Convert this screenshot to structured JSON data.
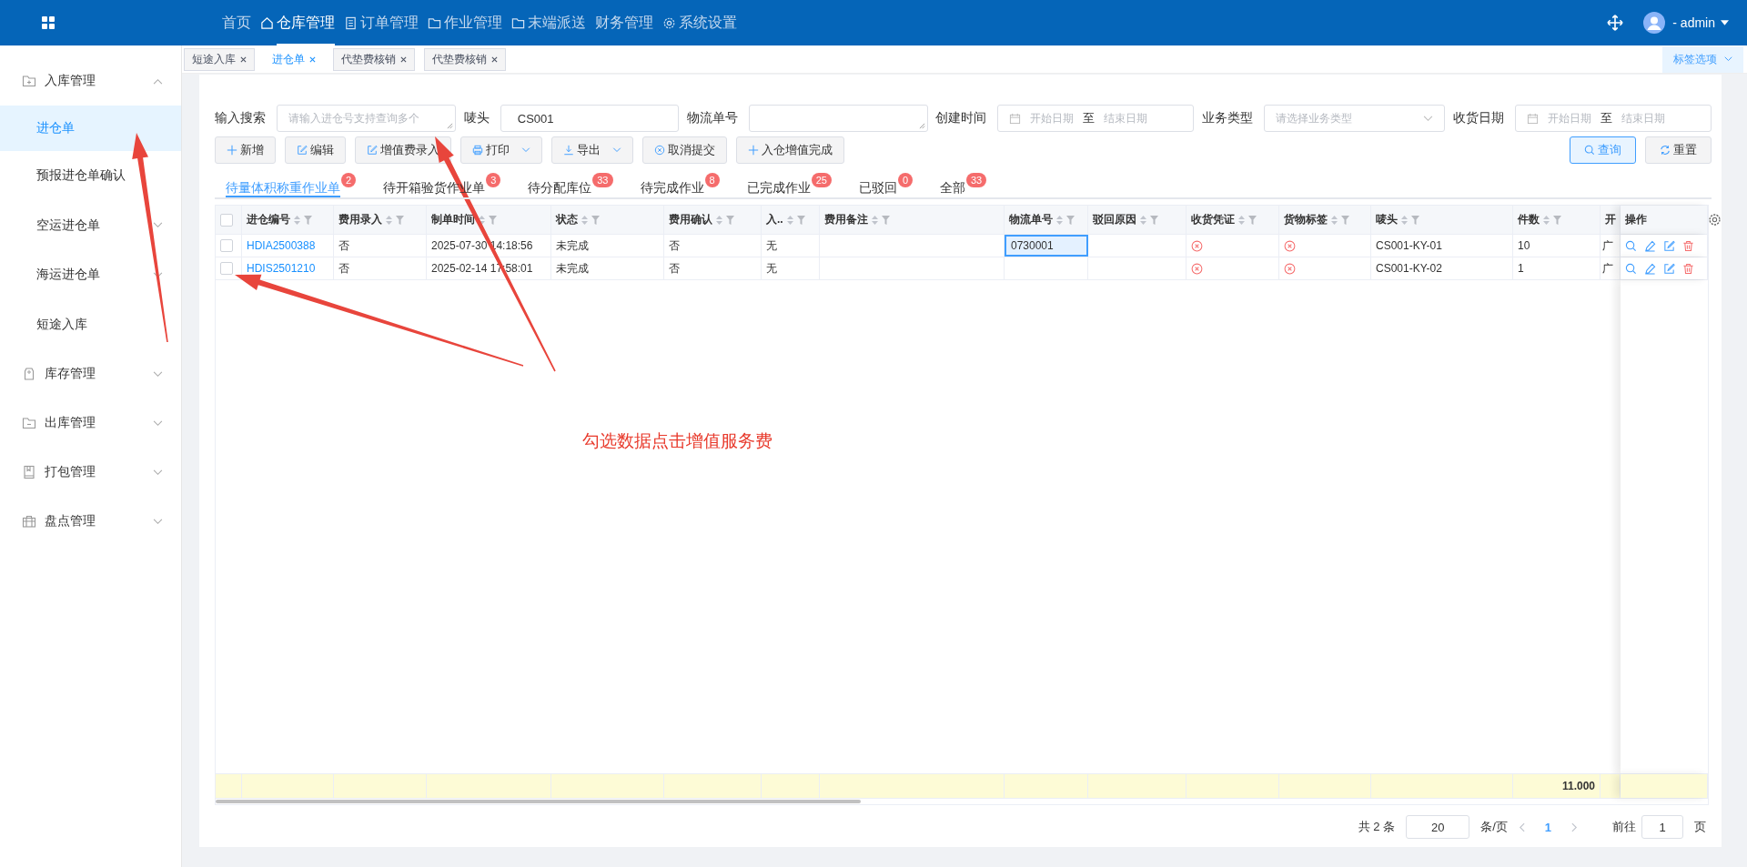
{
  "top_nav": {
    "items": [
      {
        "label": "首页",
        "selected": false
      },
      {
        "label": "仓库管理",
        "selected": true
      },
      {
        "label": "订单管理",
        "selected": false
      },
      {
        "label": "作业管理",
        "selected": false
      },
      {
        "label": "末端派送",
        "selected": false
      },
      {
        "label": "财务管理",
        "selected": false
      },
      {
        "label": "系统设置",
        "selected": false
      }
    ],
    "user": "- admin"
  },
  "tags": {
    "items": [
      {
        "label": "短途入库",
        "selected": false
      },
      {
        "label": "进仓单",
        "selected": true
      },
      {
        "label": "代垫费核销",
        "selected": false
      },
      {
        "label": "代垫费核销",
        "selected": false
      }
    ],
    "options_label": "标签选项"
  },
  "sidebar": {
    "items": [
      {
        "label": "入库管理",
        "expanded": true,
        "children": [
          {
            "label": "进仓单",
            "selected": true
          },
          {
            "label": "预报进仓单确认",
            "selected": false
          },
          {
            "label": "空运进仓单",
            "selected": false,
            "expanded": false
          },
          {
            "label": "海运进仓单",
            "selected": false,
            "expanded": false
          },
          {
            "label": "短途入库",
            "selected": false
          }
        ]
      },
      {
        "label": "库存管理",
        "expanded": false
      },
      {
        "label": "出库管理",
        "expanded": false
      },
      {
        "label": "打包管理",
        "expanded": false
      },
      {
        "label": "盘点管理",
        "expanded": false
      }
    ]
  },
  "filters": [
    {
      "kind": "textarea",
      "label": "输入搜索",
      "placeholder": "请输入进仓号支持查询多个"
    },
    {
      "kind": "input",
      "label": "唛头",
      "value": "CS001"
    },
    {
      "kind": "textarea",
      "label": "物流单号"
    },
    {
      "kind": "daterange",
      "label": "创建时间",
      "start_placeholder": "开始日期",
      "separator": "至",
      "end_placeholder": "结束日期"
    },
    {
      "kind": "select",
      "label": "业务类型",
      "placeholder": "请选择业务类型"
    },
    {
      "kind": "daterange",
      "label": "收货日期",
      "start_placeholder": "开始日期",
      "separator": "至",
      "end_placeholder": "结束日期"
    }
  ],
  "toolbar": [
    {
      "label": "新增",
      "dropdown": false
    },
    {
      "label": "编辑",
      "dropdown": false
    },
    {
      "label": "增值费录入",
      "dropdown": false
    },
    {
      "label": "打印",
      "dropdown": true
    },
    {
      "label": "导出",
      "dropdown": true
    },
    {
      "label": "取消提交",
      "dropdown": false
    },
    {
      "label": "入仓增值完成",
      "dropdown": false
    }
  ],
  "search_buttons": [
    {
      "label": "查询",
      "primary": true
    },
    {
      "label": "重置",
      "primary": false
    }
  ],
  "status_tabs": [
    {
      "label": "待量体积称重作业单",
      "count": "2",
      "selected": true
    },
    {
      "label": "待开箱验货作业单",
      "count": "3",
      "selected": false
    },
    {
      "label": "待分配库位",
      "count": "33",
      "selected": false
    },
    {
      "label": "待完成作业",
      "count": "8",
      "selected": false
    },
    {
      "label": "已完成作业",
      "count": "25",
      "selected": false
    },
    {
      "label": "已驳回",
      "count": "0",
      "selected": false
    },
    {
      "label": "全部",
      "count": "33",
      "selected": false
    }
  ],
  "table": {
    "all_checked": false,
    "columns": [
      {
        "label": "进仓编号",
        "sortable": true
      },
      {
        "label": "费用录入",
        "sortable": true
      },
      {
        "label": "制单时间",
        "sortable": true
      },
      {
        "label": "状态",
        "sortable": true
      },
      {
        "label": "费用确认",
        "sortable": true
      },
      {
        "label": "入..",
        "sortable": true
      },
      {
        "label": "费用备注",
        "sortable": true
      },
      {
        "label": "物流单号",
        "sortable": true
      },
      {
        "label": "驳回原因",
        "sortable": true
      },
      {
        "label": "收货凭证",
        "sortable": true
      },
      {
        "label": "货物标签",
        "sortable": true
      },
      {
        "label": "唛头",
        "sortable": true
      },
      {
        "label": "件数",
        "sortable": true
      },
      {
        "label": "开"
      },
      {
        "label": "操作",
        "sortable": false
      }
    ],
    "rows": [
      {
        "checked": false,
        "id": "HDIA2500388",
        "fee_entered": "否",
        "created": "2025-07-30 14:18:56",
        "status": "未完成",
        "fee_confirmed": "否",
        "column_6": "无",
        "logistics_no": "0730001",
        "logistics_focused": true,
        "receipt": false,
        "label": false,
        "mark": "CS001-KY-01",
        "pieces": "10",
        "column_14": "广"
      },
      {
        "checked": false,
        "id": "HDIS2501210",
        "fee_entered": "否",
        "created": "2025-02-14 17:58:01",
        "status": "未完成",
        "fee_confirmed": "否",
        "column_6": "无",
        "logistics_focused": false,
        "receipt": false,
        "label": false,
        "mark": "CS001-KY-02",
        "pieces": "1",
        "column_14": "广"
      }
    ],
    "summary": {
      "pieces": "11.000"
    }
  },
  "pagination": {
    "total": "共 2 条",
    "page_size": "20",
    "page_size_unit": "条/页",
    "pages": [
      {
        "label": "1",
        "selected": true
      }
    ],
    "goto_label": "前往",
    "goto_value": "1",
    "goto_unit": "页"
  },
  "annotation": {
    "text": "勾选数据点击增值服务费"
  }
}
